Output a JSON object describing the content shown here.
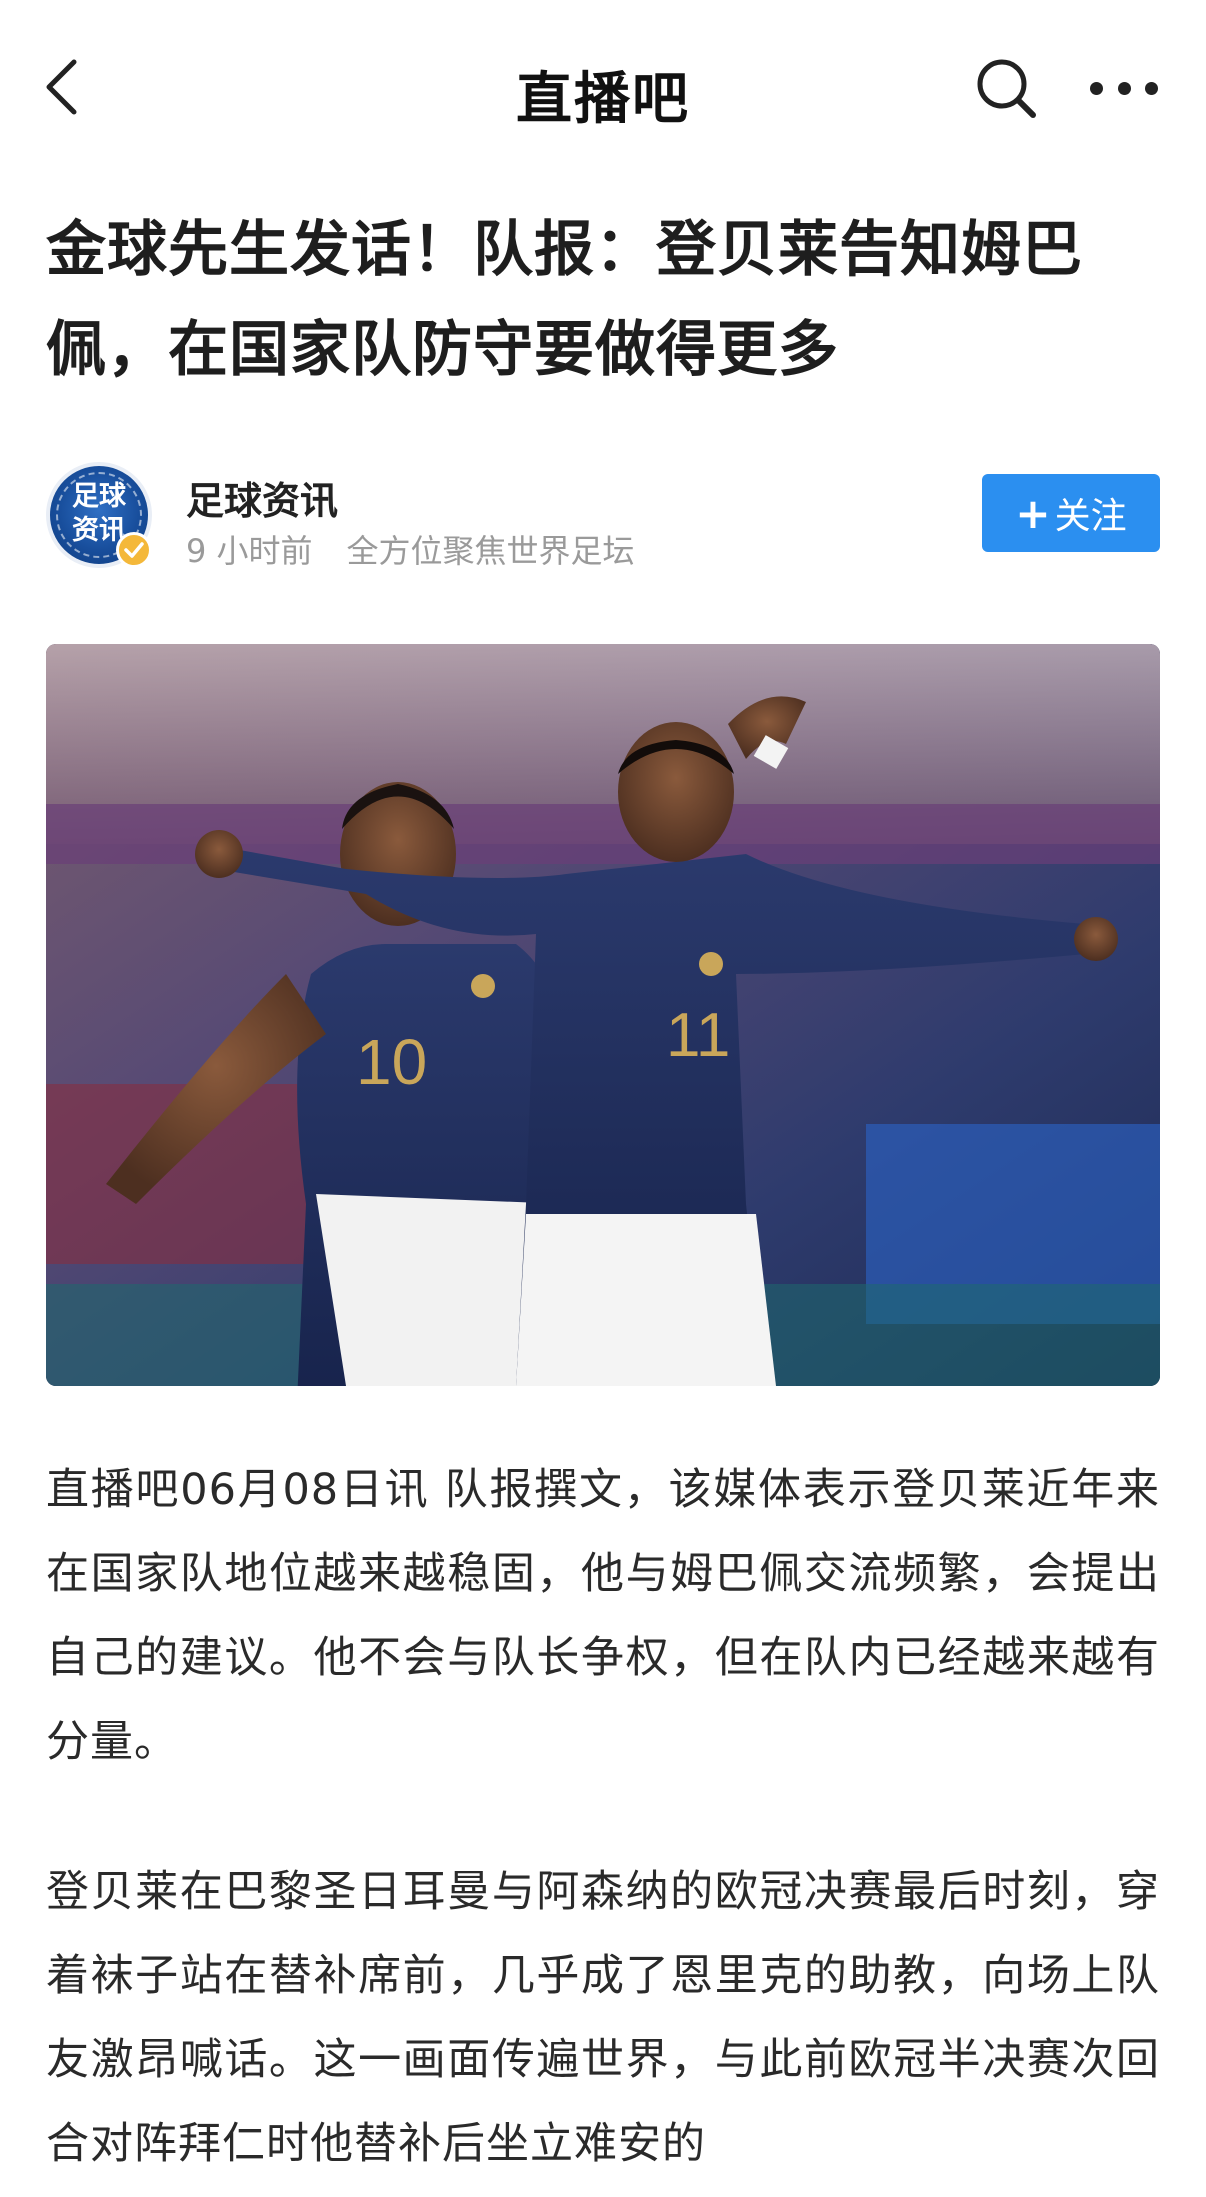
{
  "nav": {
    "title": "直播吧",
    "back_icon": "chevron-left-icon",
    "search_icon": "search-icon",
    "more_icon": "more-dots-icon"
  },
  "article": {
    "title": "金球先生发话！队报：登贝莱告知姆巴佩，在国家队防守要做得更多",
    "author": {
      "name": "足球资讯",
      "avatar_text": "足球资讯",
      "time": "9 小时前",
      "bio": "全方位聚焦世界足坛",
      "follow_label": "关注",
      "follow_plus": "+"
    },
    "hero_image": {
      "jersey_left": "10",
      "jersey_right": "11"
    },
    "paragraphs": [
      "直播吧06月08日讯  队报撰文，该媒体表示登贝莱近年来在国家队地位越来越稳固，他与姆巴佩交流频繁，会提出自己的建议。他不会与队长争权，但在队内已经越来越有分量。",
      "登贝莱在巴黎圣日耳曼与阿森纳的欧冠决赛最后时刻，穿着袜子站在替补席前，几乎成了恩里克的助教，向场上队友激昂喊话。这一画面传遍世界，与此前欧冠半决赛次回合对阵拜仁时他替补后坐立难安的"
    ]
  },
  "colors": {
    "accent": "#2b8ff0",
    "badge": "#f4b83a",
    "meta": "#9a9a9a"
  }
}
